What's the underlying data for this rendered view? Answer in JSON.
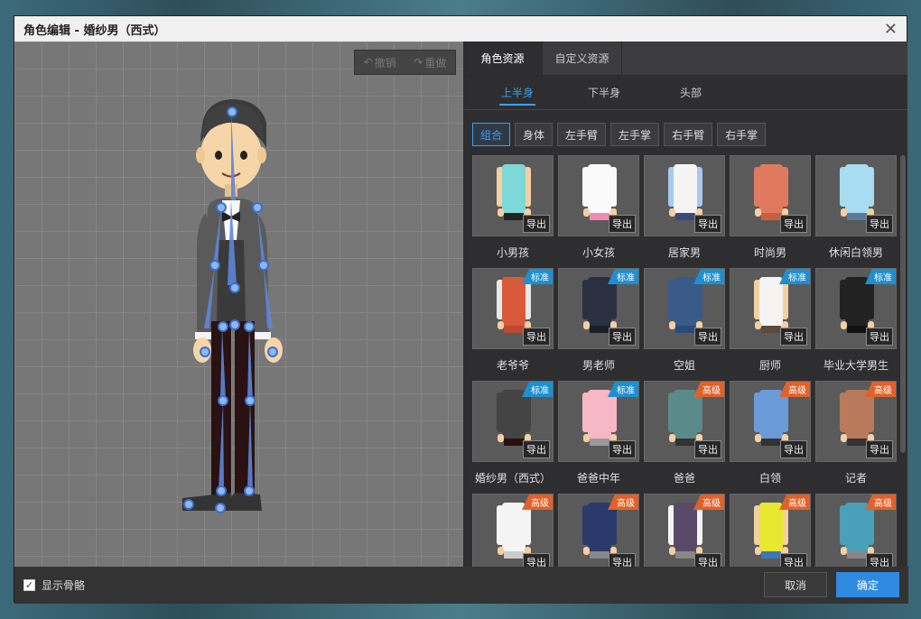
{
  "window": {
    "title": "角色编辑 - 婚纱男（西式）"
  },
  "toolbar": {
    "undo": "撤销",
    "redo": "重做"
  },
  "tabs": [
    {
      "label": "角色资源"
    },
    {
      "label": "自定义资源"
    }
  ],
  "subtabs": [
    {
      "label": "上半身"
    },
    {
      "label": "下半身"
    },
    {
      "label": "头部"
    }
  ],
  "filters": [
    {
      "label": "组合"
    },
    {
      "label": "身体"
    },
    {
      "label": "左手臂"
    },
    {
      "label": "左手掌"
    },
    {
      "label": "右手臂"
    },
    {
      "label": "右手掌"
    }
  ],
  "export_label": "导出",
  "badges": {
    "std": "标准",
    "adv": "高级"
  },
  "items": [
    {
      "name": "小男孩",
      "badge": "",
      "color": "#7fd8d8",
      "sleeve": "#f3cfa2",
      "pants": "#222"
    },
    {
      "name": "小女孩",
      "badge": "",
      "color": "#fafafa",
      "sleeve": "#fafafa",
      "pants": "#f08cb0"
    },
    {
      "name": "居家男",
      "badge": "",
      "color": "#f4f4f4",
      "sleeve": "#a8c8f0",
      "pants": "#3b4a7a"
    },
    {
      "name": "时尚男",
      "badge": "",
      "color": "#e07a5f",
      "sleeve": "#e07a5f",
      "pants": "#c86040"
    },
    {
      "name": "休闲白领男",
      "badge": "",
      "color": "#a8dcf0",
      "sleeve": "#a8dcf0",
      "pants": "#5a7a9a"
    },
    {
      "name": "老爷爷",
      "badge": "std",
      "color": "#d85a3a",
      "sleeve": "#e8e8e8",
      "pants": "#bb4a30"
    },
    {
      "name": "男老师",
      "badge": "std",
      "color": "#2a3040",
      "sleeve": "#2a3040",
      "pants": "#1a1e28"
    },
    {
      "name": "空姐",
      "badge": "std",
      "color": "#3a5a8a",
      "sleeve": "#3a5a8a",
      "pants": "#2a4a7a"
    },
    {
      "name": "厨师",
      "badge": "std",
      "color": "#f4f4f4",
      "sleeve": "#f3cfa2",
      "pants": "#5a4a3a"
    },
    {
      "name": "毕业大学男生",
      "badge": "std",
      "color": "#222",
      "sleeve": "#222",
      "pants": "#111"
    },
    {
      "name": "婚纱男（西式）",
      "badge": "std",
      "color": "#444",
      "sleeve": "#444",
      "pants": "#2a1010"
    },
    {
      "name": "爸爸中年",
      "badge": "std",
      "color": "#f6b8c4",
      "sleeve": "#f6b8c4",
      "pants": "#999"
    },
    {
      "name": "爸爸",
      "badge": "adv",
      "color": "#5a8a8a",
      "sleeve": "#5a8a8a",
      "pants": "#333"
    },
    {
      "name": "白领",
      "badge": "adv",
      "color": "#6a9ad8",
      "sleeve": "#6a9ad8",
      "pants": "#333"
    },
    {
      "name": "记者",
      "badge": "adv",
      "color": "#b87a5a",
      "sleeve": "#b87a5a",
      "pants": "#333"
    },
    {
      "name": "",
      "badge": "adv",
      "color": "#f4f4f4",
      "sleeve": "#f4f4f4",
      "pants": "#ccc"
    },
    {
      "name": "",
      "badge": "adv",
      "color": "#2a3a6a",
      "sleeve": "#2a3a6a",
      "pants": "#888"
    },
    {
      "name": "",
      "badge": "adv",
      "color": "#5a4a6a",
      "sleeve": "#f4f4f4",
      "pants": "#888"
    },
    {
      "name": "",
      "badge": "adv",
      "color": "#e8e830",
      "sleeve": "#f3cfa2",
      "pants": "#3a78b8"
    },
    {
      "name": "",
      "badge": "adv",
      "color": "#4aa0b8",
      "sleeve": "#4aa0b8",
      "pants": "#888"
    }
  ],
  "footer": {
    "show_bones": "显示骨骼",
    "show_bones_checked": true,
    "cancel": "取消",
    "ok": "确定"
  },
  "colors": {
    "accent": "#3aa0f0",
    "std_badge": "#1f8fd0",
    "adv_badge": "#e0622a"
  }
}
